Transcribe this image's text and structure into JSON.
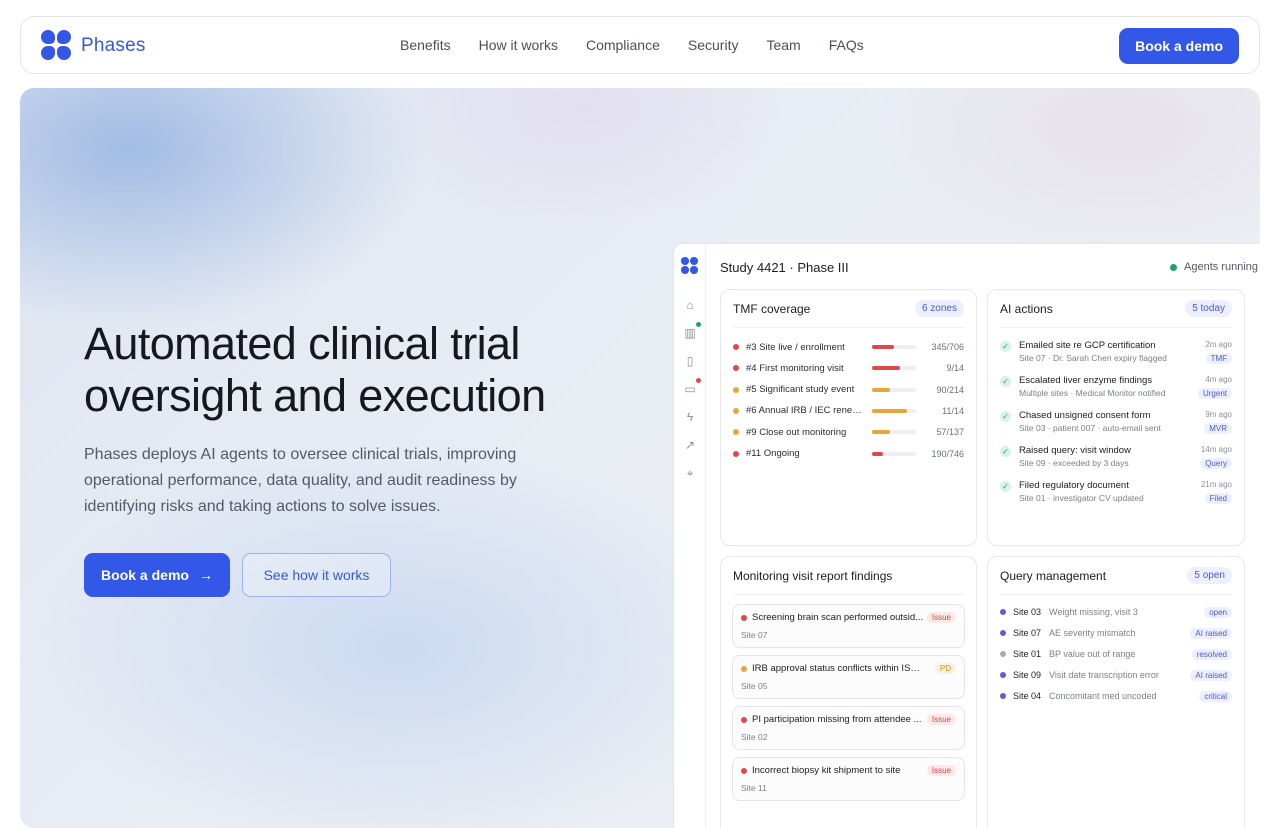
{
  "nav": {
    "brand": "Phases",
    "links": [
      "Benefits",
      "How it works",
      "Compliance",
      "Security",
      "Team",
      "FAQs"
    ],
    "cta": "Book a demo"
  },
  "hero": {
    "headline": "Automated clinical trial oversight and execution",
    "subtext": "Phases deploys AI agents to oversee clinical trials, improving operational performance, data quality, and audit readiness by identifying risks and taking actions to solve issues.",
    "primary_button": "Book a demo",
    "secondary_button": "See how it works"
  },
  "dashboard": {
    "title": "Study 4421 · Phase III",
    "status": "Agents running",
    "tmf": {
      "title": "TMF coverage",
      "badge": "6 zones",
      "rows": [
        {
          "label": "#3 Site live / enrollment",
          "count": "345/706",
          "fraction": 0.49,
          "color": "#e04848"
        },
        {
          "label": "#4 First monitoring visit",
          "count": "9/14",
          "fraction": 0.64,
          "color": "#e04848"
        },
        {
          "label": "#5 Significant study event",
          "count": "90/214",
          "fraction": 0.42,
          "color": "#e8a53a"
        },
        {
          "label": "#6 Annual IRB / IEC renew...",
          "count": "11/14",
          "fraction": 0.79,
          "color": "#e8a53a"
        },
        {
          "label": "#9 Close out monitoring",
          "count": "57/137",
          "fraction": 0.42,
          "color": "#e8a53a"
        },
        {
          "label": "#11 Ongoing",
          "count": "190/746",
          "fraction": 0.25,
          "color": "#e04848"
        }
      ]
    },
    "ai": {
      "title": "AI actions",
      "badge": "5 today",
      "rows": [
        {
          "title": "Emailed site re GCP certification",
          "detail": "Site 07 · Dr. Sarah Chen expiry flagged",
          "time": "2m ago",
          "tag": "TMF"
        },
        {
          "title": "Escalated liver enzyme findings",
          "detail": "Multiple sites · Medical Monitor notified",
          "time": "4m ago",
          "tag": "Urgent"
        },
        {
          "title": "Chased unsigned consent form",
          "detail": "Site 03 · patient 007 · auto-email sent",
          "time": "9m ago",
          "tag": "MVR"
        },
        {
          "title": "Raised query: visit window",
          "detail": "Site 09 · exceeded by 3 days",
          "time": "14m ago",
          "tag": "Query"
        },
        {
          "title": "Filed regulatory document",
          "detail": "Site 01 · investigator CV updated",
          "time": "21m ago",
          "tag": "Filed"
        }
      ]
    },
    "findings": {
      "title": "Monitoring visit report findings",
      "rows": [
        {
          "text": "Screening brain scan performed outsid...",
          "site": "Site 07",
          "tag": "Issue",
          "color": "#e04848"
        },
        {
          "text": "IRB approval status conflicts within ISF s...",
          "site": "Site 05",
          "tag": "PD",
          "color": "#e8a53a"
        },
        {
          "text": "PI participation missing from attendee ...",
          "site": "Site 02",
          "tag": "Issue",
          "color": "#e04848"
        },
        {
          "text": "Incorrect biopsy kit shipment to site",
          "site": "Site 11",
          "tag": "Issue",
          "color": "#e04848"
        }
      ]
    },
    "queries": {
      "title": "Query management",
      "badge": "5 open",
      "rows": [
        {
          "site": "Site 03",
          "desc": "Weight missing, visit 3",
          "tag": "open",
          "color": "#6a5acd"
        },
        {
          "site": "Site 07",
          "desc": "AE severity mismatch",
          "tag": "AI raised",
          "color": "#6a5acd"
        },
        {
          "site": "Site 01",
          "desc": "BP value out of range",
          "tag": "resolved",
          "color": "#a7abb5"
        },
        {
          "site": "Site 09",
          "desc": "Visit date transcription error",
          "tag": "AI raised",
          "color": "#6a5acd"
        },
        {
          "site": "Site 04",
          "desc": "Concomitant med uncoded",
          "tag": "critical",
          "color": "#6a5acd"
        }
      ]
    }
  }
}
